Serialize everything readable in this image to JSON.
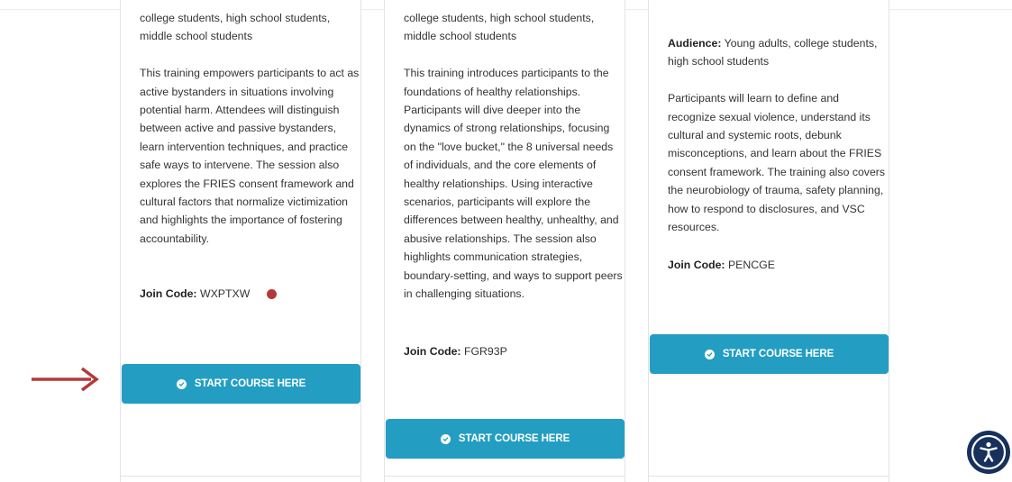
{
  "cards": [
    {
      "audience_tail": "college students, high school students, middle school students",
      "description": "This training empowers participants to act as active bystanders in situations involving potential harm. Attendees will distinguish between active and passive bystanders, learn intervention techniques, and practice safe ways to intervene. The session also explores the FRIES consent framework and cultural factors that normalize victimization and highlights the importance of fostering accountability.",
      "join_label": "Join Code:",
      "join_code": "WXPTXW",
      "button_label": "START COURSE HERE"
    },
    {
      "audience_tail": "college students, high school students, middle school students",
      "description": "This training introduces participants to the foundations of healthy relationships. Participants will dive deeper into the dynamics of strong relationships, focusing on the \"love bucket,\" the 8 universal needs of individuals, and the core elements of healthy relationships. Using interactive scenarios, participants will explore the differences between healthy, unhealthy, and abusive relationships. The session also highlights communication strategies, boundary-setting, and ways to support peers in challenging situations.",
      "join_label": "Join Code:",
      "join_code": "FGR93P",
      "button_label": "START COURSE HERE"
    },
    {
      "audience_label": "Audience:",
      "audience_value": "Young adults, college students, high school students",
      "description": "Participants will learn to define and recognize sexual violence, understand its cultural and systemic roots, debunk misconceptions, and learn about the FRIES consent framework. The training also covers the neurobiology of trauma, safety planning, how to respond to disclosures, and VSC resources.",
      "join_label": "Join Code:",
      "join_code": "PENCGE",
      "button_label": "START COURSE HERE"
    }
  ],
  "colors": {
    "button": "#239ec2",
    "annotation_red": "#b63838",
    "accessibility": "#17305c"
  },
  "icons": {
    "button_icon": "check-circle-icon",
    "annotation_arrow": "arrow-right-icon",
    "accessibility": "accessibility-icon"
  }
}
